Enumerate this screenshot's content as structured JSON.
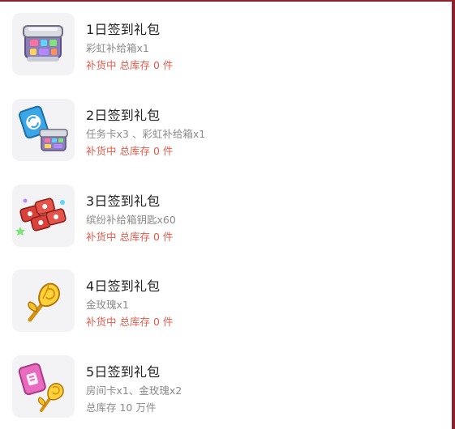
{
  "colors": {
    "frame": "#8f1f2a",
    "stock_warning": "#e25a4a",
    "muted_text": "#8a8a8a"
  },
  "gifts": [
    {
      "title": "1日签到礼包",
      "desc": "彩虹补给箱x1",
      "stock": "补货中 总库存 0 件",
      "stock_state": "restocking",
      "icon": "rainbow-supply-box-icon"
    },
    {
      "title": "2日签到礼包",
      "desc": "任务卡x3 、彩虹补给箱x1",
      "stock": "补货中 总库存 0 件",
      "stock_state": "restocking",
      "icon": "task-card-and-supply-box-icon"
    },
    {
      "title": "3日签到礼包",
      "desc": "缤纷补给箱钥匙x60",
      "stock": "补货中 总库存 0 件",
      "stock_state": "restocking",
      "icon": "supply-box-keys-icon"
    },
    {
      "title": "4日签到礼包",
      "desc": "金玫瑰x1",
      "stock": "补货中 总库存 0 件",
      "stock_state": "restocking",
      "icon": "gold-rose-icon"
    },
    {
      "title": "5日签到礼包",
      "desc": "房间卡x1、金玫瑰x2",
      "stock": "总库存 10 万件",
      "stock_state": "available",
      "icon": "room-card-and-gold-rose-icon"
    }
  ]
}
